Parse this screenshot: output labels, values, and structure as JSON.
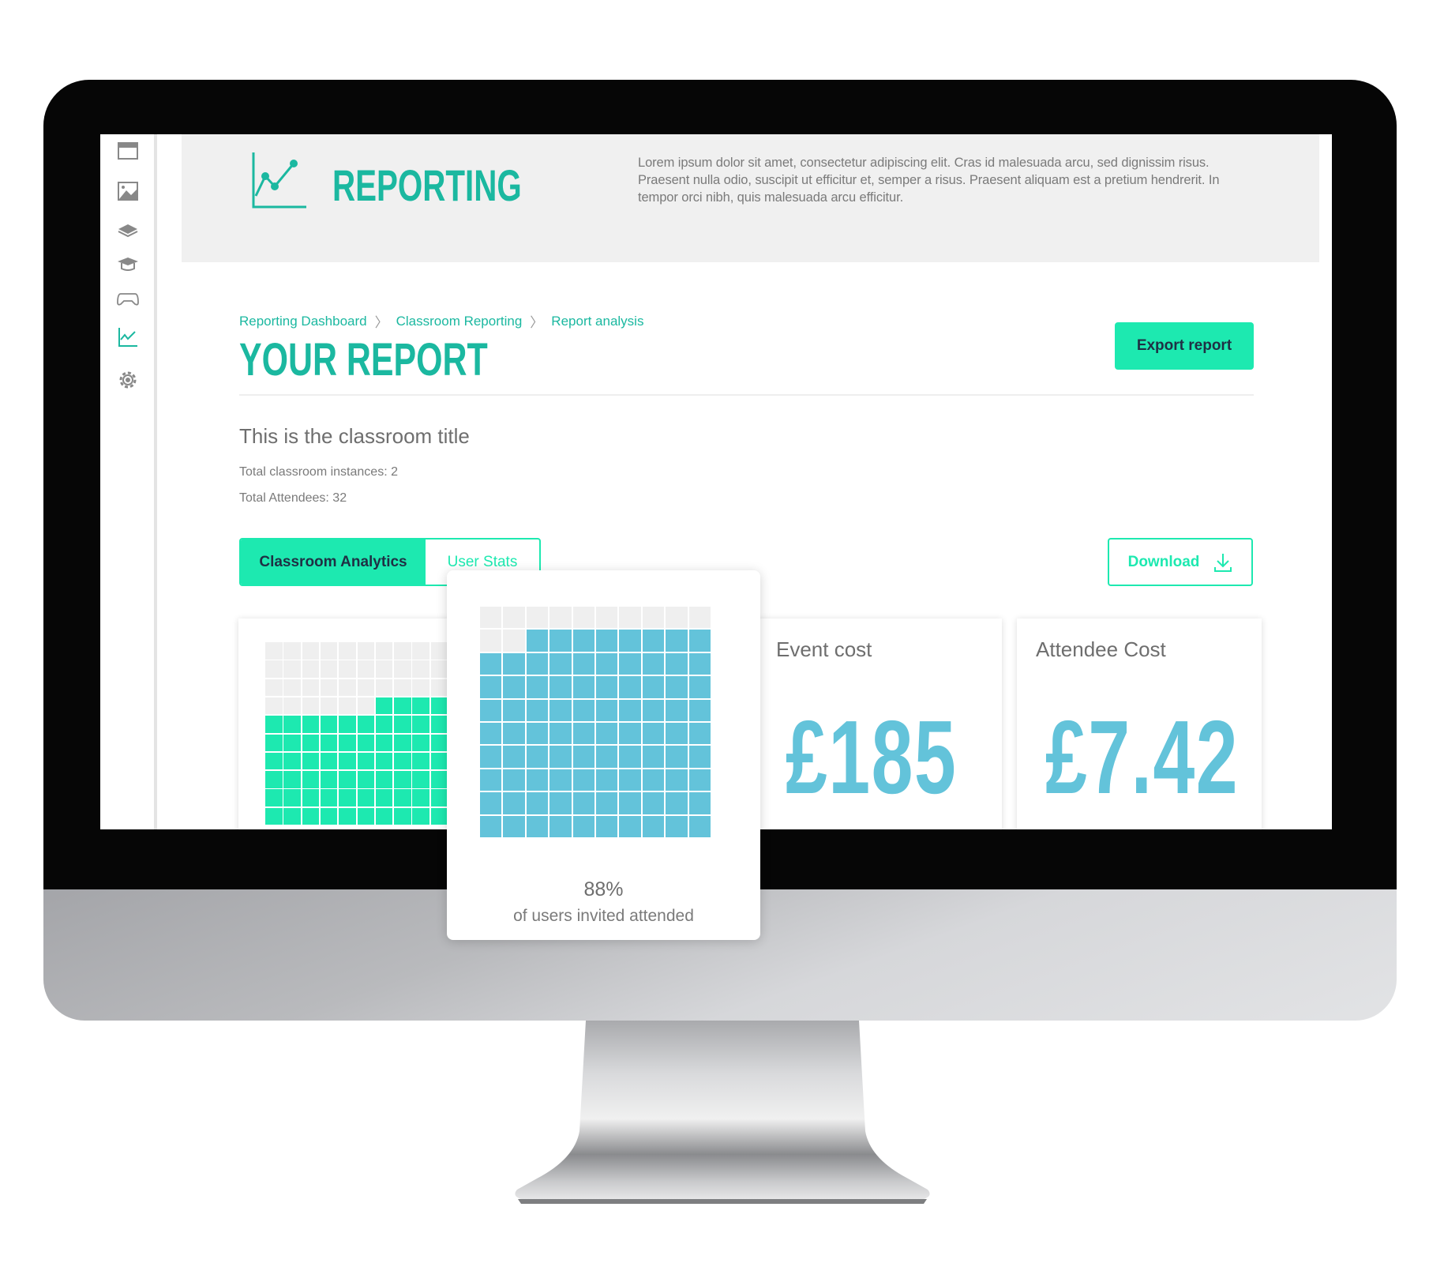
{
  "sidebar": {
    "items": [
      {
        "icon": "browser-window-icon"
      },
      {
        "icon": "image-icon"
      },
      {
        "icon": "layers-icon"
      },
      {
        "icon": "graduation-cap-icon"
      },
      {
        "icon": "gamepad-icon"
      },
      {
        "icon": "chart-icon",
        "active": true
      },
      {
        "icon": "gear-icon"
      }
    ]
  },
  "header": {
    "title": "REPORTING",
    "icon": "line-chart-icon",
    "description": "Lorem ipsum dolor sit amet, consectetur adipiscing elit. Cras id malesuada arcu, sed dignissim risus. Praesent nulla odio, suscipit ut efficitur et, semper a risus. Praesent aliquam est a pretium hendrerit. In tempor orci nibh, quis malesuada arcu efficitur."
  },
  "breadcrumb": [
    "Reporting Dashboard",
    "Classroom Reporting",
    "Report analysis"
  ],
  "page_title": "YOUR REPORT",
  "export_label": "Export report",
  "classroom": {
    "title": "This is the classroom title",
    "instances": "Total classroom instances: 2",
    "attendees": "Total Attendees: 32"
  },
  "tabs": [
    {
      "label": "Classroom Analytics",
      "active": true
    },
    {
      "label": "User Stats",
      "active": false
    }
  ],
  "download_label": "Download",
  "cards": [
    {
      "label": "Event cost",
      "value": "£185"
    },
    {
      "label": "Attendee Cost",
      "value": "£7.42"
    }
  ],
  "waffle_green": {
    "filled": 64,
    "total": 100,
    "color": "#1de9b0"
  },
  "popup": {
    "percent": "88%",
    "caption": "of users invited attended",
    "filled": 88,
    "total": 100,
    "color": "#63c3da"
  },
  "colors": {
    "accent": "#1de9b0",
    "title": "#1bb8a0",
    "value": "#63c3da",
    "empty": "#efefef"
  }
}
